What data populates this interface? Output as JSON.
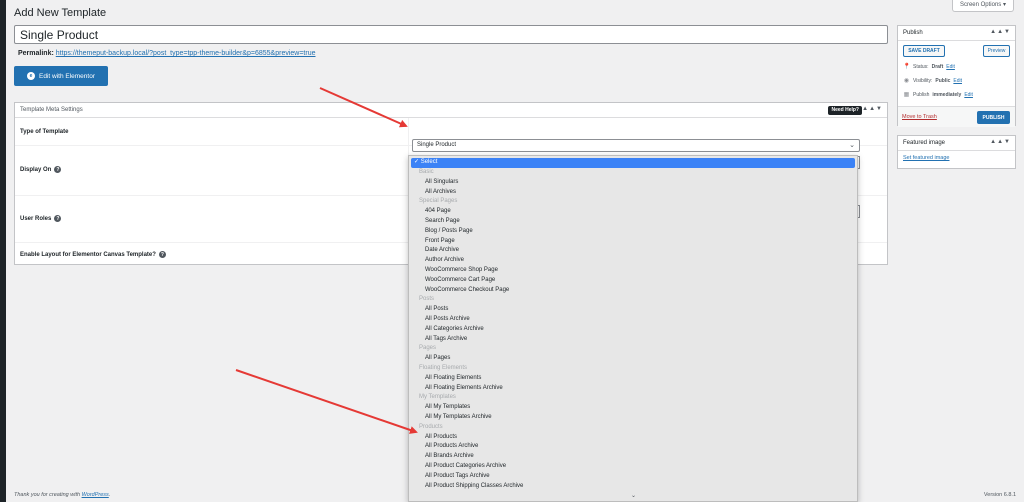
{
  "page": {
    "title": "Add New Template",
    "screen_options": "Screen Options ▾"
  },
  "post": {
    "title": "Single Product",
    "permalink_label": "Permalink:",
    "permalink_url": "https://themeput-backup.local/?post_type=tpp-theme-builder&p=6855&preview=true"
  },
  "elementor": {
    "button": "Edit with Elementor",
    "icon": "elementor-icon"
  },
  "meta_box": {
    "title": "Template Meta Settings",
    "need_help": "Need Help?",
    "arrows": "▲▲▼",
    "rows": {
      "type_label": "Type of Template",
      "type_value": "Single Product",
      "display_label": "Display On",
      "roles_label": "User Roles",
      "canvas_label": "Enable Layout for Elementor Canvas Template?"
    }
  },
  "publish": {
    "title": "Publish",
    "save_draft": "SAVE DRAFT",
    "preview": "Preview",
    "status_label": "Status:",
    "status_value": "Draft",
    "visibility_label": "Visibility:",
    "visibility_value": "Public",
    "publish_label": "Publish",
    "publish_value": "immediately",
    "edit": "Edit",
    "trash": "Move to Trash",
    "publish_button": "PUBLISH"
  },
  "featured": {
    "title": "Featured image",
    "link": "Set featured image"
  },
  "dropdown": {
    "selected": "✓ Select",
    "items": [
      {
        "t": "group",
        "label": "Basic"
      },
      {
        "t": "opt",
        "label": "All Singulars"
      },
      {
        "t": "opt",
        "label": "All Archives"
      },
      {
        "t": "group",
        "label": "Special Pages"
      },
      {
        "t": "opt",
        "label": "404 Page"
      },
      {
        "t": "opt",
        "label": "Search Page"
      },
      {
        "t": "opt",
        "label": "Blog / Posts Page"
      },
      {
        "t": "opt",
        "label": "Front Page"
      },
      {
        "t": "opt",
        "label": "Date Archive"
      },
      {
        "t": "opt",
        "label": "Author Archive"
      },
      {
        "t": "opt",
        "label": "WooCommerce Shop Page"
      },
      {
        "t": "opt",
        "label": "WooCommerce Cart Page"
      },
      {
        "t": "opt",
        "label": "WooCommerce Checkout Page"
      },
      {
        "t": "group",
        "label": "Posts"
      },
      {
        "t": "opt",
        "label": "All Posts"
      },
      {
        "t": "opt",
        "label": "All Posts Archive"
      },
      {
        "t": "opt",
        "label": "All Categories Archive"
      },
      {
        "t": "opt",
        "label": "All Tags Archive"
      },
      {
        "t": "group",
        "label": "Pages"
      },
      {
        "t": "opt",
        "label": "All Pages"
      },
      {
        "t": "group",
        "label": "Floating Elements"
      },
      {
        "t": "opt",
        "label": "All Floating Elements"
      },
      {
        "t": "opt",
        "label": "All Floating Elements Archive"
      },
      {
        "t": "group",
        "label": "My Templates"
      },
      {
        "t": "opt",
        "label": "All My Templates"
      },
      {
        "t": "opt",
        "label": "All My Templates Archive"
      },
      {
        "t": "group",
        "label": "Products"
      },
      {
        "t": "opt",
        "label": "All Products"
      },
      {
        "t": "opt",
        "label": "All Products Archive"
      },
      {
        "t": "opt",
        "label": "All Brands Archive"
      },
      {
        "t": "opt",
        "label": "All Product Categories Archive"
      },
      {
        "t": "opt",
        "label": "All Product Tags Archive"
      },
      {
        "t": "opt",
        "label": "All Product Shipping Classes Archive"
      }
    ],
    "scroll_indicator": "⌄"
  },
  "footer": {
    "thanks_prefix": "Thank you for creating with ",
    "thanks_link": "WordPress",
    "thanks_suffix": ".",
    "version": "Version 6.8.1"
  },
  "colors": {
    "accent": "#2271b1",
    "selected_option": "#3b82f6",
    "annotation_arrow": "#e53935",
    "trash": "#b32d2e"
  }
}
